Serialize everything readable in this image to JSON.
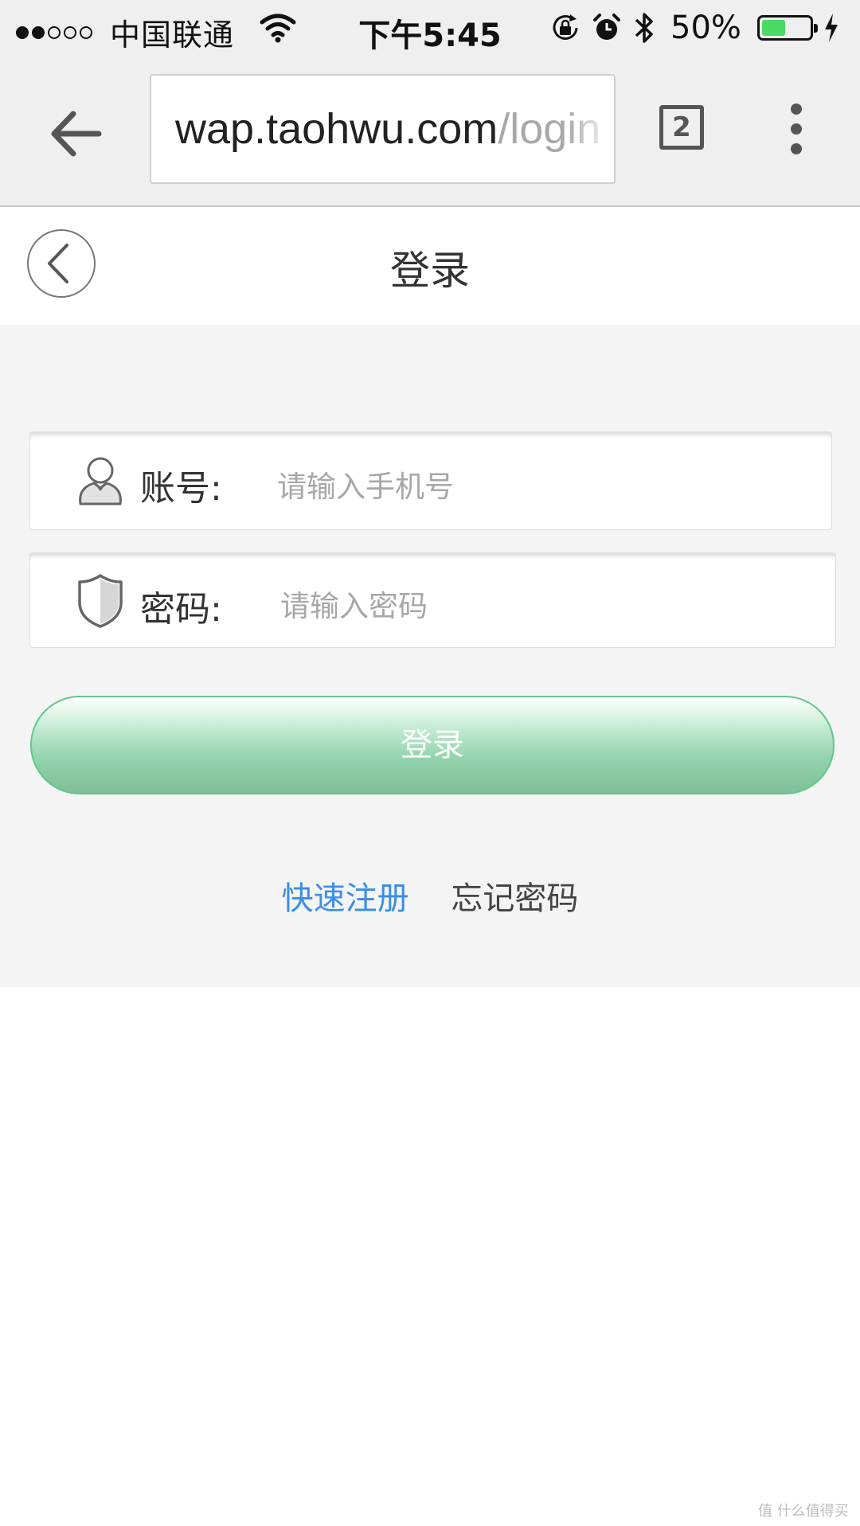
{
  "status_bar": {
    "carrier": "中国联通",
    "time": "下午5:45",
    "battery_percent": "50%",
    "battery_level": 0.5,
    "signal_strength": 2,
    "signal_max": 5
  },
  "browser": {
    "url_host": "wap.taohwu.com",
    "url_path": "/login",
    "tab_count": "2"
  },
  "page": {
    "title": "登录"
  },
  "form": {
    "account_label": "账号:",
    "account_placeholder": "请输入手机号",
    "password_label": "密码:",
    "password_placeholder": "请输入密码",
    "login_button": "登录"
  },
  "links": {
    "register": "快速注册",
    "forgot_password": "忘记密码"
  },
  "watermark": "值 什么值得买",
  "colors": {
    "link_blue": "#3a8ee6",
    "button_green": "#7ebe97",
    "page_bg": "#f4f4f4"
  }
}
